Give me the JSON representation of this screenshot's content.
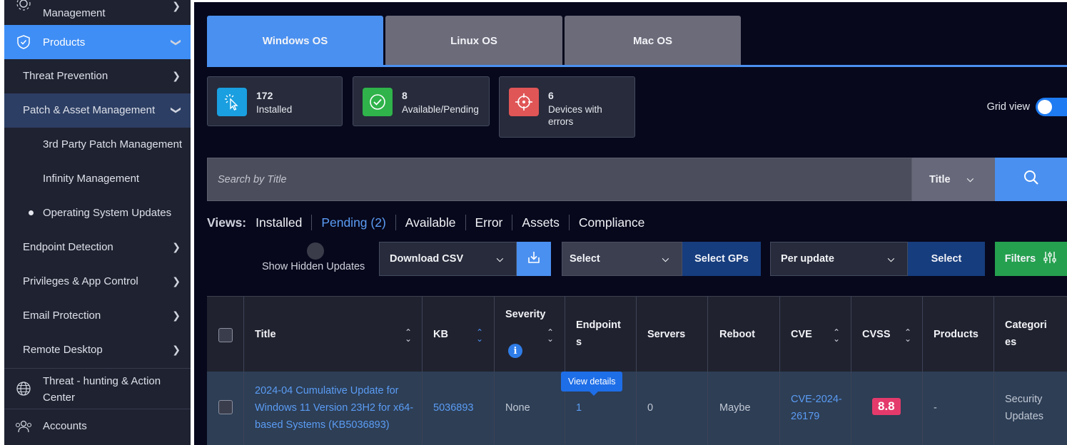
{
  "sidebar": {
    "top_item": "Management",
    "products": "Products",
    "items": [
      {
        "label": "Threat Prevention"
      },
      {
        "label": "Patch & Asset Management"
      },
      {
        "label": "3rd Party Patch Management"
      },
      {
        "label": "Infinity Management"
      },
      {
        "label": "Operating System Updates"
      },
      {
        "label": "Endpoint Detection"
      },
      {
        "label": "Privileges & App Control"
      },
      {
        "label": "Email Protection"
      },
      {
        "label": "Remote Desktop"
      }
    ],
    "threat_hunting": "Threat - hunting & Action Center",
    "accounts": "Accounts"
  },
  "os_tabs": [
    "Windows OS",
    "Linux OS",
    "Mac OS"
  ],
  "summary": [
    {
      "count": "172",
      "label": "Installed",
      "color": "#1a9fe0"
    },
    {
      "count": "8",
      "label": "Available/Pending",
      "color": "#2fb34a"
    },
    {
      "count": "6",
      "label": "Devices with errors",
      "color": "#e05556"
    }
  ],
  "grid_view": "Grid view",
  "search": {
    "placeholder": "Search by Title",
    "field": "Title"
  },
  "views": {
    "label": "Views:",
    "items": [
      "Installed",
      "Pending (2)",
      "Available",
      "Error",
      "Assets",
      "Compliance"
    ],
    "active": "Pending (2)"
  },
  "controls": {
    "show_hidden": "Show Hidden Updates",
    "download_csv": "Download CSV",
    "select1": "Select",
    "select_gps": "Select GPs",
    "per_update": "Per update",
    "select2": "Select",
    "filters": "Filters"
  },
  "table": {
    "headers": {
      "title": "Title",
      "kb": "KB",
      "severity": "Severity",
      "endpoints": "Endpoints",
      "servers": "Servers",
      "reboot": "Reboot",
      "cve": "CVE",
      "cvss": "CVSS",
      "products": "Products",
      "categories": "Categories"
    },
    "rows": [
      {
        "title": "2024-04 Cumulative Update for Windows 11 Version 23H2 for x64-based Systems (KB5036893)",
        "kb": "5036893",
        "severity": "None",
        "endpoints": "1",
        "servers": "0",
        "reboot": "Maybe",
        "cve": "CVE-2024-26179",
        "cvss": "8.8",
        "products": "-",
        "categories": "Security Updates"
      }
    ],
    "tooltip": "View details"
  },
  "colors": {
    "accent": "#4a90f0",
    "cvss_badge": "#e43a6b",
    "sidebar_bg": "#1f2230",
    "main_bg": "#07081c"
  }
}
